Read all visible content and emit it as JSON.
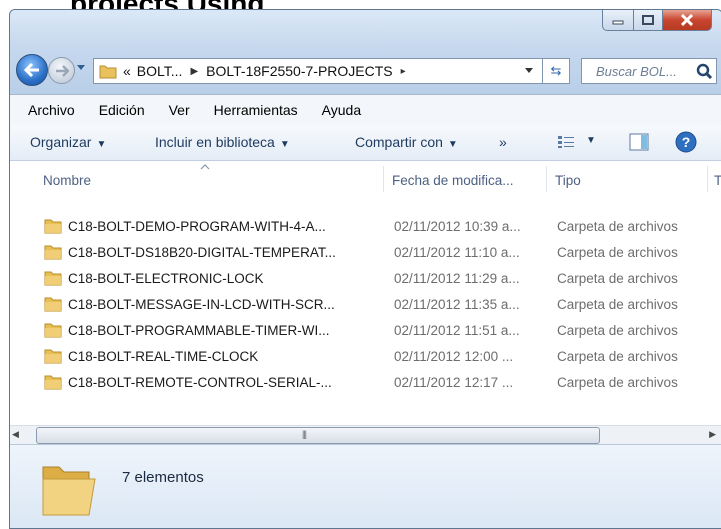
{
  "caption_overlay": "projects Using",
  "window": {
    "colors": {
      "accent": "#2a6fc7",
      "close": "#c8452e"
    }
  },
  "address": {
    "prefix": "«",
    "crumbs": [
      "BOLT...",
      "BOLT-18F2550-7-PROJECTS"
    ],
    "trailing_separator": "▸"
  },
  "search": {
    "placeholder": "Buscar BOL..."
  },
  "menu": [
    "Archivo",
    "Edición",
    "Ver",
    "Herramientas",
    "Ayuda"
  ],
  "commands": {
    "organize": "Organizar",
    "include": "Incluir en biblioteca",
    "share": "Compartir con",
    "more": "»"
  },
  "columns": {
    "name": "Nombre",
    "date": "Fecha de modifica...",
    "type": "Tipo",
    "extra": "T"
  },
  "files": [
    {
      "name": "C18-BOLT-DEMO-PROGRAM-WITH-4-A...",
      "date": "02/11/2012 10:39 a...",
      "type": "Carpeta de archivos"
    },
    {
      "name": "C18-BOLT-DS18B20-DIGITAL-TEMPERAT...",
      "date": "02/11/2012 11:10 a...",
      "type": "Carpeta de archivos"
    },
    {
      "name": "C18-BOLT-ELECTRONIC-LOCK",
      "date": "02/11/2012 11:29 a...",
      "type": "Carpeta de archivos"
    },
    {
      "name": "C18-BOLT-MESSAGE-IN-LCD-WITH-SCR...",
      "date": "02/11/2012 11:35 a...",
      "type": "Carpeta de archivos"
    },
    {
      "name": "C18-BOLT-PROGRAMMABLE-TIMER-WI...",
      "date": "02/11/2012 11:51 a...",
      "type": "Carpeta de archivos"
    },
    {
      "name": "C18-BOLT-REAL-TIME-CLOCK",
      "date": "02/11/2012 12:00 ...",
      "type": "Carpeta de archivos"
    },
    {
      "name": "C18-BOLT-REMOTE-CONTROL-SERIAL-...",
      "date": "02/11/2012 12:17 ...",
      "type": "Carpeta de archivos"
    }
  ],
  "status": {
    "count": "7 elementos"
  },
  "icons": [
    "back-arrow-icon",
    "forward-arrow-icon",
    "folder-icon",
    "refresh-icon",
    "search-icon",
    "views-icon",
    "preview-pane-icon",
    "help-icon"
  ]
}
